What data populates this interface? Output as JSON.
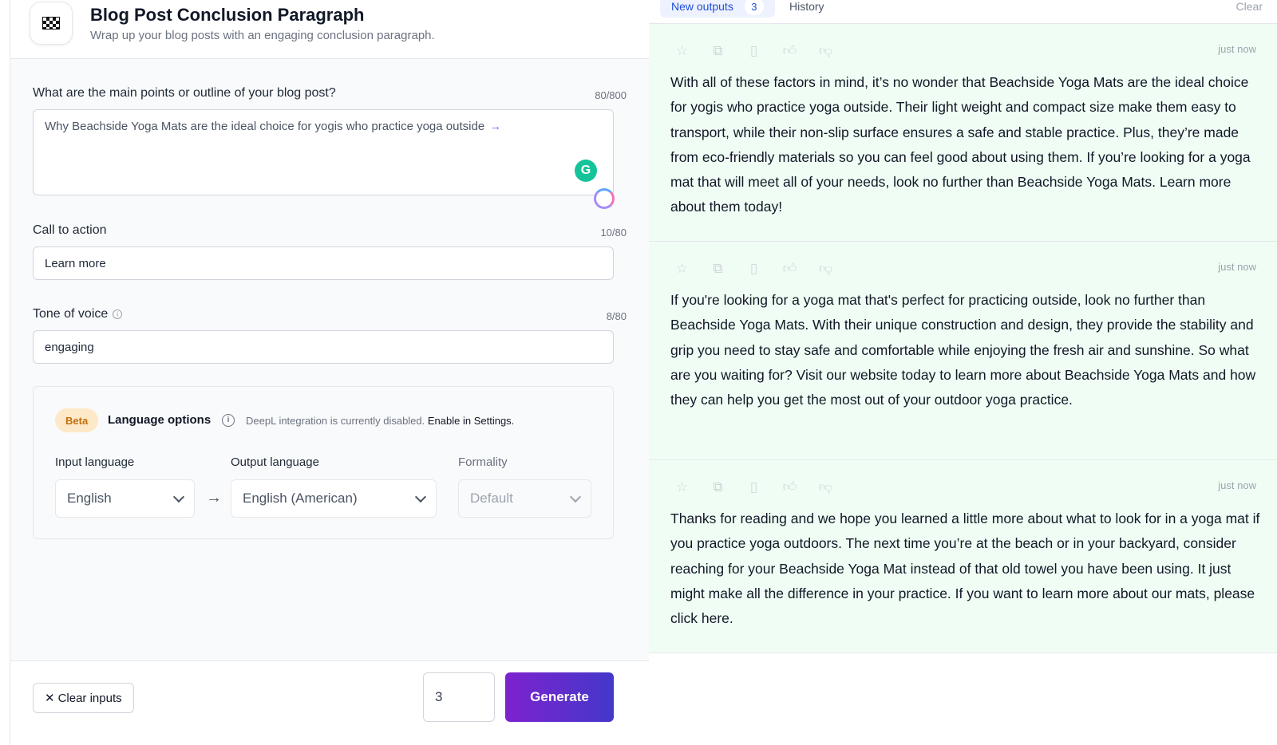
{
  "tool": {
    "title": "Blog Post Conclusion Paragraph",
    "subtitle": "Wrap up your blog posts with an engaging conclusion paragraph."
  },
  "fields": {
    "outline": {
      "label": "What are the main points or outline of your blog post?",
      "counter": "80/800",
      "value": "Why Beachside Yoga Mats are the ideal choice for yogis who practice yoga outside",
      "arrow": "→"
    },
    "cta": {
      "label": "Call to action",
      "counter": "10/80",
      "value": "Learn more"
    },
    "tone": {
      "label": "Tone of voice",
      "counter": "8/80",
      "value": "engaging"
    }
  },
  "language": {
    "badge": "Beta",
    "title": "Language options",
    "notice": "DeepL integration is currently disabled.",
    "enable_link": "Enable in Settings.",
    "input_label": "Input language",
    "input_value": "English",
    "output_label": "Output language",
    "output_value": "English (American)",
    "formality_label": "Formality",
    "formality_value": "Default"
  },
  "footer": {
    "clear_label": "Clear inputs",
    "count": "3",
    "generate_label": "Generate"
  },
  "tabs": {
    "new_outputs_label": "New outputs",
    "new_outputs_count": "3",
    "history_label": "History",
    "clear_label": "Clear"
  },
  "outputs": [
    {
      "time": "just now",
      "text": "With all of these factors in mind, it’s no wonder that Beachside Yoga Mats are the ideal choice for yogis who practice yoga outside. Their light weight and compact size make them easy to transport, while their non-slip surface ensures a safe and stable practice. Plus, they’re made from eco-friendly materials so you can feel good about using them. If you’re looking for a yoga mat that will meet all of your needs, look no further than Beachside Yoga Mats. Learn more about them today!"
    },
    {
      "time": "just now",
      "text": "If you're looking for a yoga mat that's perfect for practicing outside, look no further than Beachside Yoga Mats. With their unique construction and design, they provide the stability and grip you need to stay safe and comfortable while enjoying the fresh air and sunshine. So what are you waiting for? Visit our website today to learn more about Beachside Yoga Mats and how they can help you get the most out of your outdoor yoga practice."
    },
    {
      "time": "just now",
      "text": "Thanks for reading and we hope you learned a little more about what to look for in a yoga mat if you practice yoga outdoors. The next time you’re at the beach or in your backyard, consider reaching for your Beachside Yoga Mat instead of that old towel you have been using. It just might make all the difference in your practice. If you want to learn more about our mats, please click here."
    }
  ],
  "icons": {
    "tool": "checkered-flag-icon",
    "grammarly": "grammarly-icon",
    "actions": [
      "star-icon",
      "copy-icon",
      "document-icon",
      "thumbs-up-icon",
      "thumbs-down-icon"
    ]
  },
  "colors": {
    "accent": "#7e22ce",
    "accent_end": "#4338ca",
    "output_bg": "#f0fdf4",
    "beta_bg": "#fde8c8",
    "beta_text": "#c2700c"
  }
}
